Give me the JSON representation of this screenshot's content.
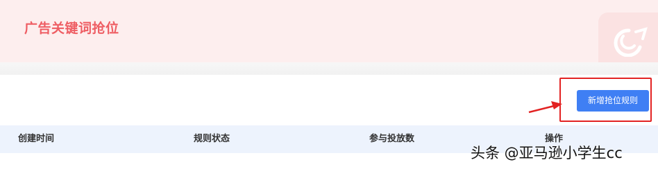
{
  "header": {
    "title": "广告关键词抢位"
  },
  "toolbar": {
    "add_rule_label": "新增抢位规则"
  },
  "table": {
    "columns": [
      "创建时间",
      "规则状态",
      "参与投放数",
      "操作"
    ]
  },
  "watermark": {
    "text": "头条 @亚马逊小学生cc"
  },
  "colors": {
    "banner_bg": "#fdeeee",
    "title": "#ee5d63",
    "button": "#3f7ff4",
    "highlight": "#e22222",
    "table_header_bg": "#edf3fd"
  },
  "icons": {
    "banner_logo": "brand-logo-icon",
    "annotation_arrow": "arrow-right-icon"
  }
}
